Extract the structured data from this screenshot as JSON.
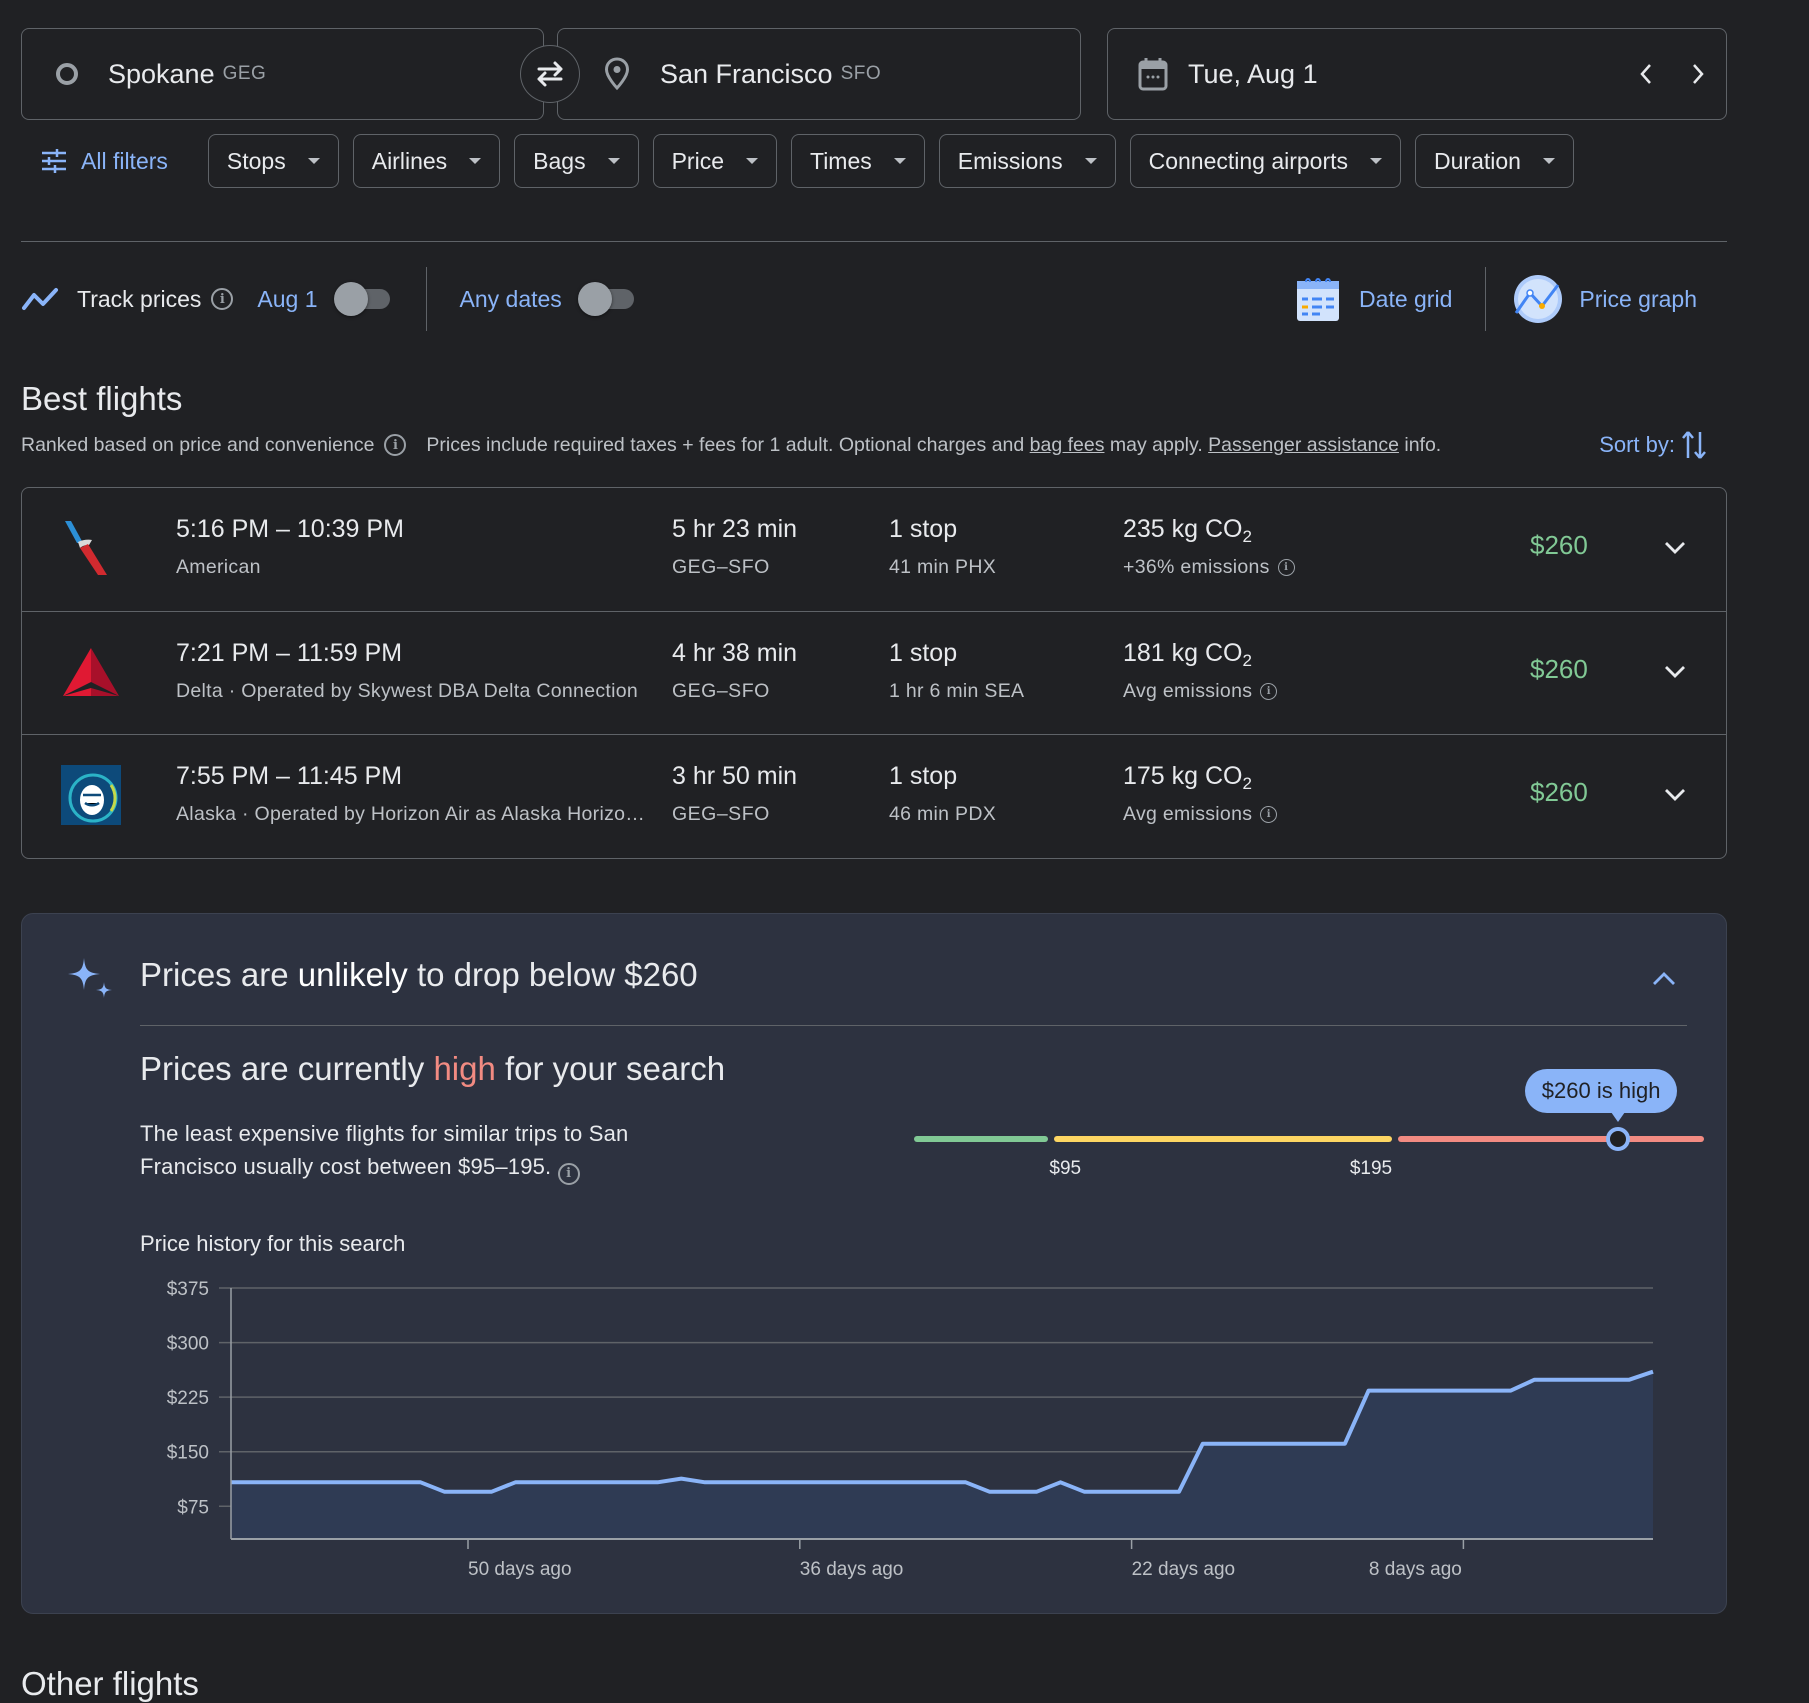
{
  "search": {
    "origin": {
      "city": "Spokane",
      "code": "GEG",
      "icon": "origin-circle-icon"
    },
    "swap_icon": "swap-arrows-icon",
    "destination": {
      "city": "San Francisco",
      "code": "SFO",
      "icon": "location-pin-icon"
    },
    "date": {
      "label": "Tue, Aug 1",
      "icon": "calendar-icon",
      "prev_icon": "chevron-left-icon",
      "next_icon": "chevron-right-icon"
    }
  },
  "filters": {
    "all_filters_label": "All filters",
    "chips": [
      "Stops",
      "Airlines",
      "Bags",
      "Price",
      "Times",
      "Emissions",
      "Connecting airports",
      "Duration"
    ]
  },
  "toolbar": {
    "track_prices_label": "Track prices",
    "track_date_label": "Aug 1",
    "track_toggle_on": false,
    "any_dates_label": "Any dates",
    "any_dates_toggle_on": false,
    "date_grid_label": "Date grid",
    "price_graph_label": "Price graph"
  },
  "best_flights": {
    "title": "Best flights",
    "ranked_text": "Ranked based on price and convenience",
    "prices_text_1": "Prices include required taxes + fees for 1 adult. Optional charges and ",
    "bag_fees_link": "bag fees",
    "prices_text_2": " may apply. ",
    "passenger_link": "Passenger assistance",
    "prices_text_3": " info.",
    "sort_label": "Sort by:",
    "flights": [
      {
        "times": "5:16 PM – 10:39 PM",
        "airline": "American",
        "duration": "5 hr 23 min",
        "route": "GEG–SFO",
        "stops": "1 stop",
        "layover": "41 min PHX",
        "co2_value": "235 kg CO",
        "co2_sub": "2",
        "emissions": "+36% emissions",
        "price": "$260",
        "logo": "american-airlines-logo"
      },
      {
        "times": "7:21 PM – 11:59 PM",
        "airline": "Delta · Operated by Skywest DBA Delta Connection",
        "duration": "4 hr 38 min",
        "route": "GEG–SFO",
        "stops": "1 stop",
        "layover": "1 hr 6 min SEA",
        "co2_value": "181 kg CO",
        "co2_sub": "2",
        "emissions": "Avg emissions",
        "price": "$260",
        "logo": "delta-logo"
      },
      {
        "times": "7:55 PM – 11:45 PM",
        "airline": "Alaska · Operated by Horizon Air as Alaska Horizo…",
        "duration": "3 hr 50 min",
        "route": "GEG–SFO",
        "stops": "1 stop",
        "layover": "46 min PDX",
        "co2_value": "175 kg CO",
        "co2_sub": "2",
        "emissions": "Avg emissions",
        "price": "$260",
        "logo": "alaska-airlines-logo"
      }
    ]
  },
  "insights": {
    "headline_1": "Prices are ",
    "headline_em": "unlikely",
    "headline_2": " to drop below $260",
    "status_1": "Prices are currently ",
    "status_high": "high",
    "status_2": " for your search",
    "description": "The least expensive flights for similar trips to San Francisco usually cost between $95–195.",
    "range": {
      "low": "$95",
      "high": "$195",
      "current_label": "$260 is high",
      "low_value": 95,
      "high_value": 195,
      "current_value": 260,
      "min_value": 55,
      "max_value": 285
    },
    "colors": {
      "low": "#81c995",
      "typical": "#fdd663",
      "high": "#f28b82",
      "accent": "#8ab4f8"
    },
    "history_title": "Price history for this search"
  },
  "chart_data": {
    "type": "area",
    "title": "Price history for this search",
    "xlabel": "",
    "ylabel": "",
    "x_unit": "days ago",
    "xlim": [
      60,
      0
    ],
    "ylim": [
      30,
      375
    ],
    "y_ticks": [
      75,
      150,
      225,
      300,
      375
    ],
    "y_tick_labels": [
      "$75",
      "$150",
      "$225",
      "$300",
      "$375"
    ],
    "x_ticks": [
      50,
      36,
      22,
      8
    ],
    "x_tick_labels": [
      "50 days ago",
      "36 days ago",
      "22 days ago",
      "8 days ago"
    ],
    "grid": true,
    "series": [
      {
        "name": "Price",
        "x": [
          60,
          52,
          51,
          49,
          48,
          42,
          41,
          40,
          29,
          28,
          26,
          25,
          24,
          20,
          19,
          13,
          12,
          6,
          5,
          1,
          0
        ],
        "y": [
          108,
          108,
          95,
          95,
          108,
          108,
          113,
          108,
          108,
          95,
          95,
          108,
          95,
          95,
          161,
          161,
          234,
          234,
          249,
          249,
          260
        ]
      }
    ]
  },
  "other_flights": {
    "title": "Other flights"
  }
}
